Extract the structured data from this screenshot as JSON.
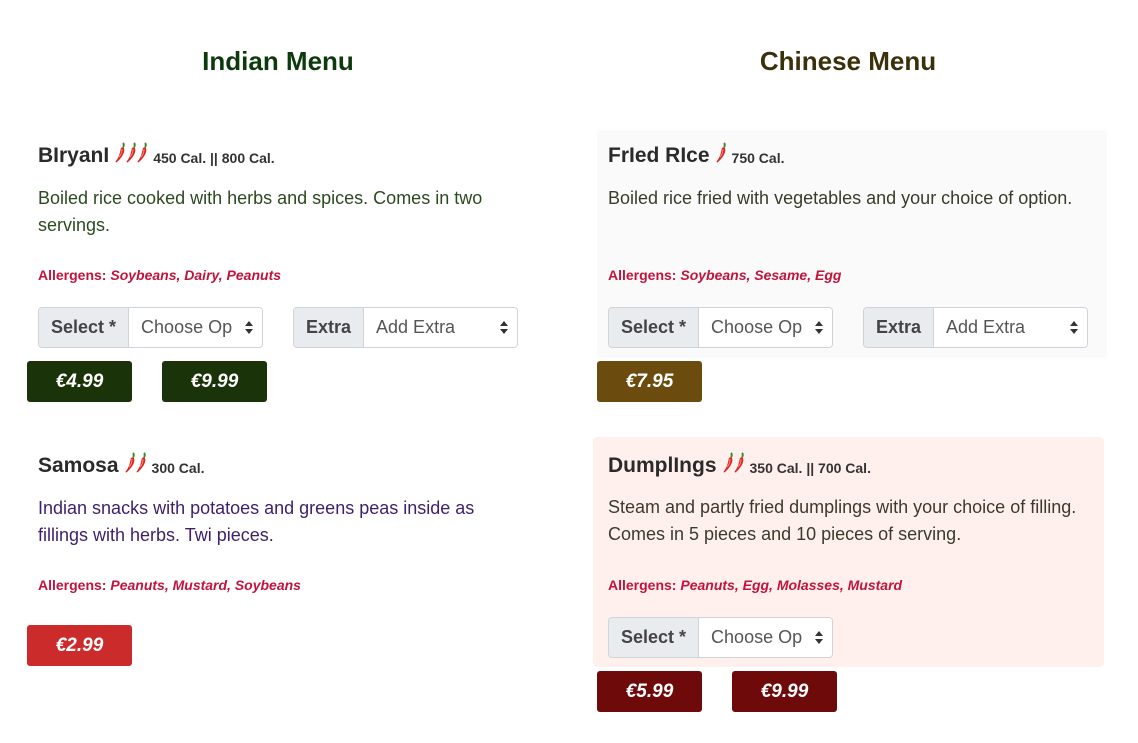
{
  "indian": {
    "title": "Indian Menu",
    "items": [
      {
        "name": "BIryanI",
        "spice_level": 3,
        "calories": "450 Cal. || 800 Cal.",
        "description": "Boiled rice cooked with herbs and spices. Comes in two servings.",
        "allergens_label": "Allergens:",
        "allergens": "Soybeans, Dairy, Peanuts",
        "select": {
          "label": "Select *",
          "value": "Choose Op"
        },
        "extra": {
          "label": "Extra",
          "value": "Add Extra"
        },
        "prices": [
          "€4.99",
          "€9.99"
        ],
        "price_color": "#1a3309",
        "desc_color": "#2b4a1f"
      },
      {
        "name": "Samosa",
        "spice_level": 2,
        "calories": "300 Cal.",
        "description": "Indian snacks with potatoes and greens peas inside as fillings with herbs. Twi pieces.",
        "allergens_label": "Allergens:",
        "allergens": "Peanuts, Mustard, Soybeans",
        "prices": [
          "€2.99"
        ],
        "price_color": "#cc2b2b",
        "desc_color": "#3e1f6b"
      }
    ]
  },
  "chinese": {
    "title": "Chinese Menu",
    "items": [
      {
        "name": "FrIed RIce",
        "spice_level": 1,
        "calories": "750 Cal.",
        "description": "Boiled rice fried with vegetables and your choice of option.",
        "allergens_label": "Allergens:",
        "allergens": "Soybeans, Sesame, Egg",
        "select": {
          "label": "Select *",
          "value": "Choose Op"
        },
        "extra": {
          "label": "Extra",
          "value": "Add Extra"
        },
        "prices": [
          "€7.95"
        ],
        "price_color": "#6b4c0e",
        "card_bg": "#fafafa",
        "desc_color": "#3b3b2b"
      },
      {
        "name": "DumplIngs",
        "spice_level": 2,
        "calories": "350 Cal. || 700 Cal.",
        "description": "Steam and partly fried dumplings with your choice of filling. Comes in 5 pieces and 10 pieces of serving.",
        "allergens_label": "Allergens:",
        "allergens": "Peanuts, Egg, Molasses, Mustard",
        "select": {
          "label": "Select *",
          "value": "Choose Op"
        },
        "prices": [
          "€5.99",
          "€9.99"
        ],
        "price_color": "#6e0a0a",
        "card_bg": "#fff0ee",
        "desc_color": "#3b3b2b"
      }
    ]
  },
  "icons": {
    "spice": "chili-pepper-icon",
    "dropdown": "select-caret-icon"
  }
}
